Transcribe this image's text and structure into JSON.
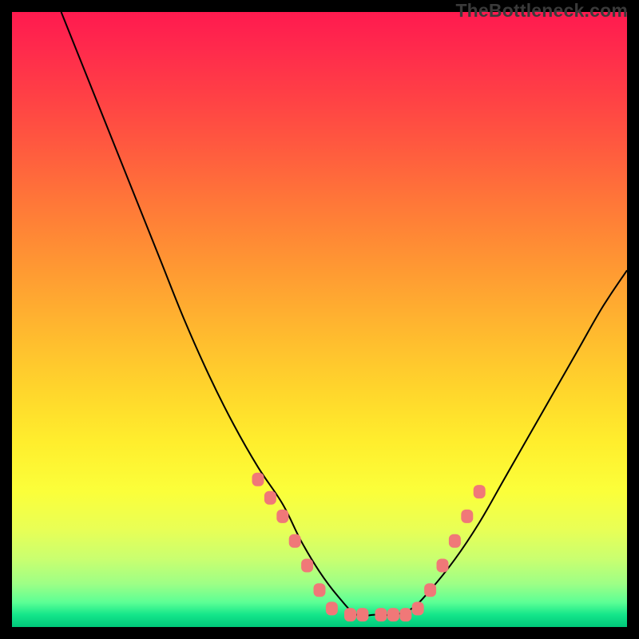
{
  "watermark": "TheBottleneck.com",
  "chart_data": {
    "type": "line",
    "title": "",
    "xlabel": "",
    "ylabel": "",
    "xlim": [
      0,
      100
    ],
    "ylim": [
      0,
      100
    ],
    "grid": false,
    "legend": false,
    "background_gradient": {
      "orientation": "vertical",
      "stops": [
        {
          "pos": 0.0,
          "color": "#ff1a4f"
        },
        {
          "pos": 0.5,
          "color": "#ffbf2e"
        },
        {
          "pos": 0.85,
          "color": "#e9ff55"
        },
        {
          "pos": 1.0,
          "color": "#00c87a"
        }
      ]
    },
    "series": [
      {
        "name": "bottleneck-curve",
        "color": "#000000",
        "x": [
          8,
          12,
          16,
          20,
          24,
          28,
          32,
          36,
          40,
          44,
          47,
          50,
          53,
          56,
          59,
          62,
          65,
          68,
          72,
          76,
          80,
          84,
          88,
          92,
          96,
          100
        ],
        "y": [
          100,
          90,
          80,
          70,
          60,
          50,
          41,
          33,
          26,
          20,
          14,
          9,
          5,
          2,
          2,
          2,
          3,
          6,
          11,
          17,
          24,
          31,
          38,
          45,
          52,
          58
        ]
      }
    ],
    "markers": {
      "color": "#f07878",
      "shape": "rounded-rect",
      "points": [
        {
          "x": 40,
          "y": 24
        },
        {
          "x": 42,
          "y": 21
        },
        {
          "x": 44,
          "y": 18
        },
        {
          "x": 46,
          "y": 14
        },
        {
          "x": 48,
          "y": 10
        },
        {
          "x": 50,
          "y": 6
        },
        {
          "x": 52,
          "y": 3
        },
        {
          "x": 55,
          "y": 2
        },
        {
          "x": 57,
          "y": 2
        },
        {
          "x": 60,
          "y": 2
        },
        {
          "x": 62,
          "y": 2
        },
        {
          "x": 64,
          "y": 2
        },
        {
          "x": 66,
          "y": 3
        },
        {
          "x": 68,
          "y": 6
        },
        {
          "x": 70,
          "y": 10
        },
        {
          "x": 72,
          "y": 14
        },
        {
          "x": 74,
          "y": 18
        },
        {
          "x": 76,
          "y": 22
        }
      ]
    }
  }
}
